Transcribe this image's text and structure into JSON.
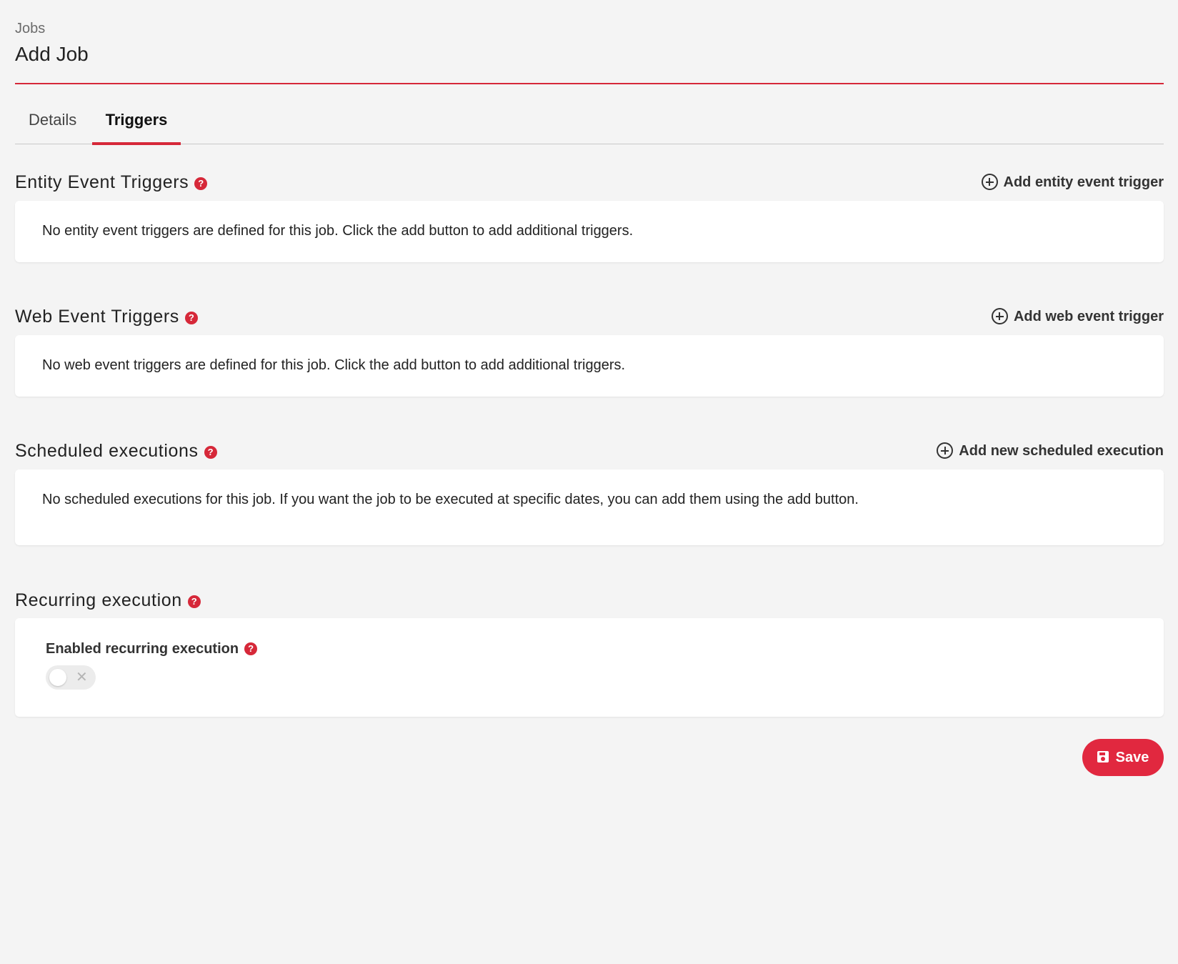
{
  "header": {
    "breadcrumb": "Jobs",
    "title": "Add Job"
  },
  "tabs": [
    {
      "label": "Details",
      "active": false
    },
    {
      "label": "Triggers",
      "active": true
    }
  ],
  "sections": {
    "entity_event": {
      "title": "Entity Event Triggers",
      "add_label": "Add entity event trigger",
      "empty_text": "No entity event triggers are defined for this job. Click the add button to add additional triggers."
    },
    "web_event": {
      "title": "Web Event Triggers",
      "add_label": "Add web event trigger",
      "empty_text": "No web event triggers are defined for this job. Click the add button to add additional triggers."
    },
    "scheduled": {
      "title": "Scheduled executions",
      "add_label": "Add new scheduled execution",
      "empty_text": "No scheduled executions for this job. If you want the job to be executed at specific dates, you can add them using the add button."
    },
    "recurring": {
      "title": "Recurring execution",
      "field_label": "Enabled recurring execution",
      "enabled": false
    }
  },
  "actions": {
    "save_label": "Save"
  },
  "icons": {
    "help": "question-circle-icon",
    "add": "plus-circle-icon",
    "save": "floppy-disk-icon",
    "toggle_off": "x-icon"
  },
  "colors": {
    "accent": "#e1283f",
    "background": "#f4f4f4",
    "card": "#ffffff"
  }
}
